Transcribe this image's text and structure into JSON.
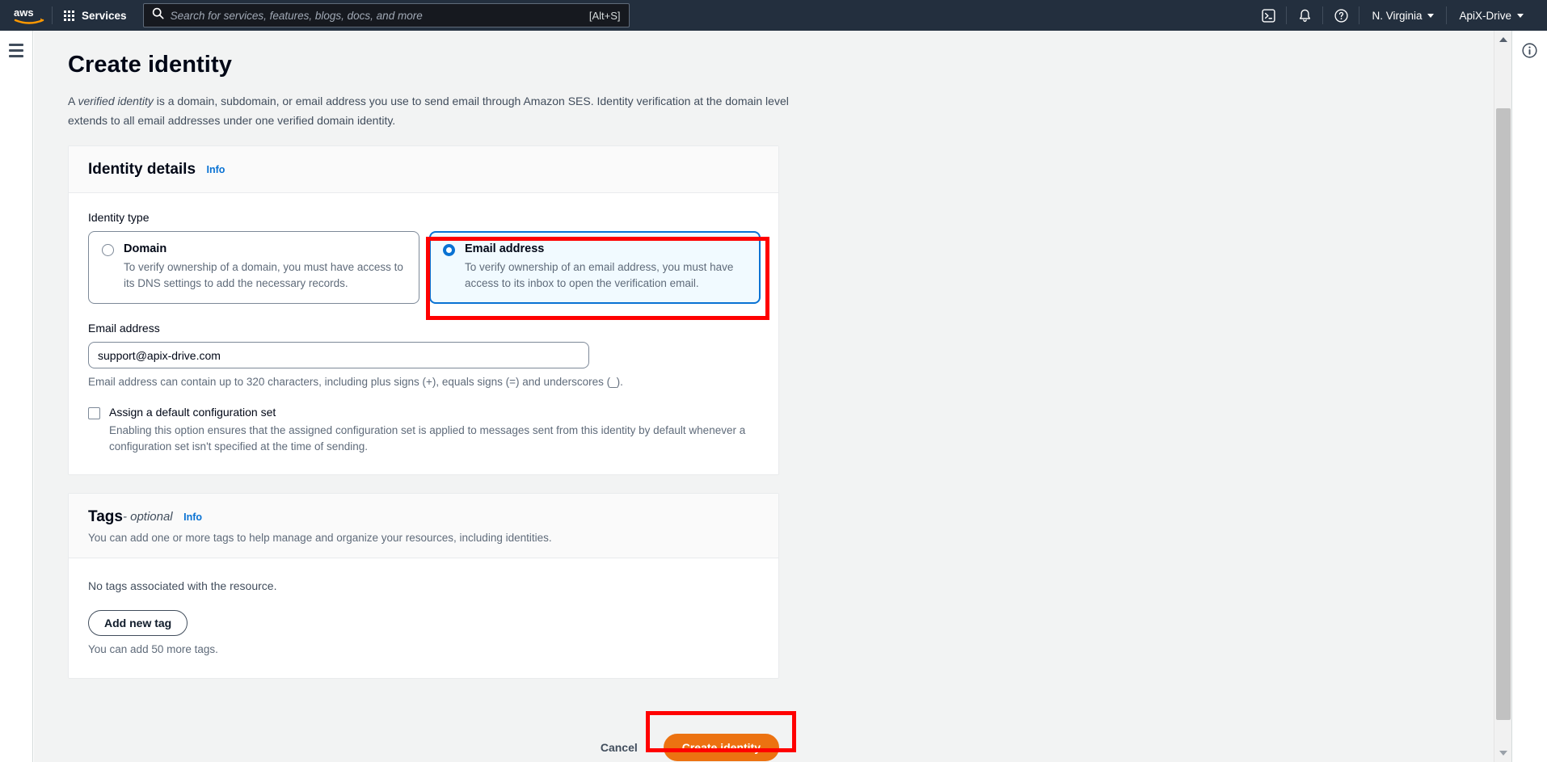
{
  "topnav": {
    "logo_alt": "aws",
    "services_label": "Services",
    "search_placeholder": "Search for services, features, blogs, docs, and more",
    "search_value": "",
    "search_shortcut": "[Alt+S]",
    "cloudshell_icon": "cloudshell-icon",
    "notifications_icon": "bell-icon",
    "help_icon": "question-circle-icon",
    "region": "N. Virginia",
    "account": "ApiX-Drive"
  },
  "page": {
    "title": "Create identity",
    "description_pre": "A ",
    "description_em": "verified identity",
    "description_post": " is a domain, subdomain, or email address you use to send email through Amazon SES. Identity verification at the domain level extends to all email addresses under one verified domain identity."
  },
  "identity_details": {
    "title": "Identity details",
    "info_label": "Info",
    "identity_type_label": "Identity type",
    "options": [
      {
        "id": "domain",
        "title": "Domain",
        "description": "To verify ownership of a domain, you must have access to its DNS settings to add the necessary records.",
        "selected": false
      },
      {
        "id": "email-address",
        "title": "Email address",
        "description": "To verify ownership of an email address, you must have access to its inbox to open the verification email.",
        "selected": true
      }
    ],
    "email_label": "Email address",
    "email_value": "support@apix-drive.com",
    "email_placeholder": "",
    "email_hint": "Email address can contain up to 320 characters, including plus signs (+), equals signs (=) and underscores (_).",
    "config_set_checkbox_label": "Assign a default configuration set",
    "config_set_checkbox_checked": false,
    "config_set_description": "Enabling this option ensures that the assigned configuration set is applied to messages sent from this identity by default whenever a configuration set isn't specified at the time of sending."
  },
  "tags": {
    "title": "Tags",
    "optional_suffix": "- optional",
    "info_label": "Info",
    "description": "You can add one or more tags to help manage and organize your resources, including identities.",
    "empty_message": "No tags associated with the resource.",
    "add_button": "Add new tag",
    "remaining_note": "You can add 50 more tags."
  },
  "footer": {
    "cancel_label": "Cancel",
    "submit_label": "Create identity"
  },
  "colors": {
    "nav_background": "#232f3e",
    "accent_blue": "#0972d3",
    "primary_orange": "#ec7211",
    "annotation_red": "#ff0000",
    "selected_tile_bg": "#f1faff"
  }
}
